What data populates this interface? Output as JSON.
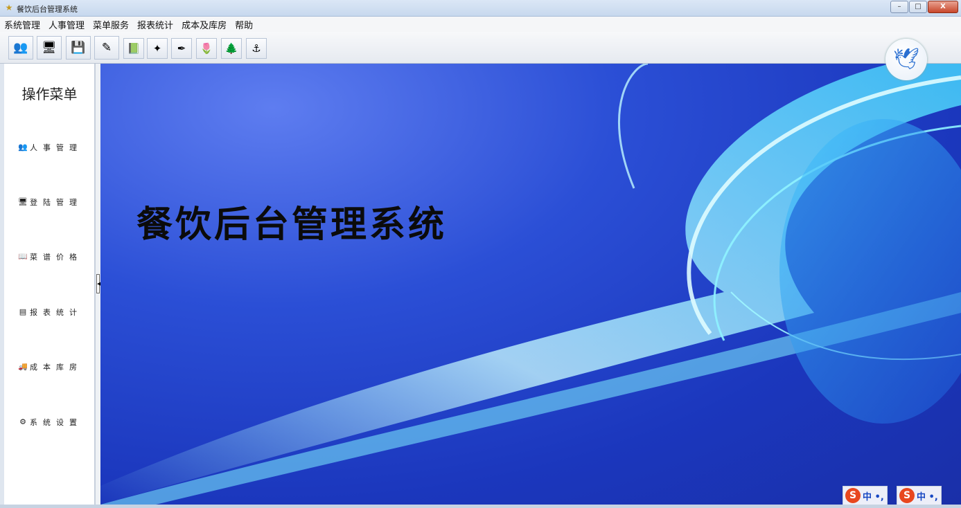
{
  "window": {
    "title": "餐饮后台管理系统",
    "minimize": "–",
    "maximize": "□",
    "close": "X"
  },
  "menubar": {
    "items": [
      "系统管理",
      "人事管理",
      "菜单服务",
      "报表统计",
      "成本及库房",
      "帮助"
    ]
  },
  "toolbar": {
    "icons": [
      "users-icon",
      "monitor-icon",
      "save-icon",
      "edit-icon",
      "book-icon",
      "star-icon",
      "pen-icon",
      "tulip-icon",
      "tree-icon",
      "anchor-icon"
    ]
  },
  "sidebar": {
    "title": "操作菜单",
    "items": [
      {
        "label": "人事管理",
        "icon": "users-icon"
      },
      {
        "label": "登陆管理",
        "icon": "computer-icon"
      },
      {
        "label": "菜谱价格",
        "icon": "book-icon"
      },
      {
        "label": "报表统计",
        "icon": "report-icon"
      },
      {
        "label": "成本库房",
        "icon": "truck-icon"
      },
      {
        "label": "系统设置",
        "icon": "gear-icon"
      }
    ]
  },
  "main": {
    "title": "餐饮后台管理系统"
  },
  "tray": {
    "ime1": "S",
    "ime1_text": "中 •,",
    "ime2": "S",
    "ime2_text": "中 •,"
  },
  "colors": {
    "background_blue": "#2b4fd6",
    "swirl_cyan": "#7ff0ff",
    "ime_red": "#e8471f"
  }
}
